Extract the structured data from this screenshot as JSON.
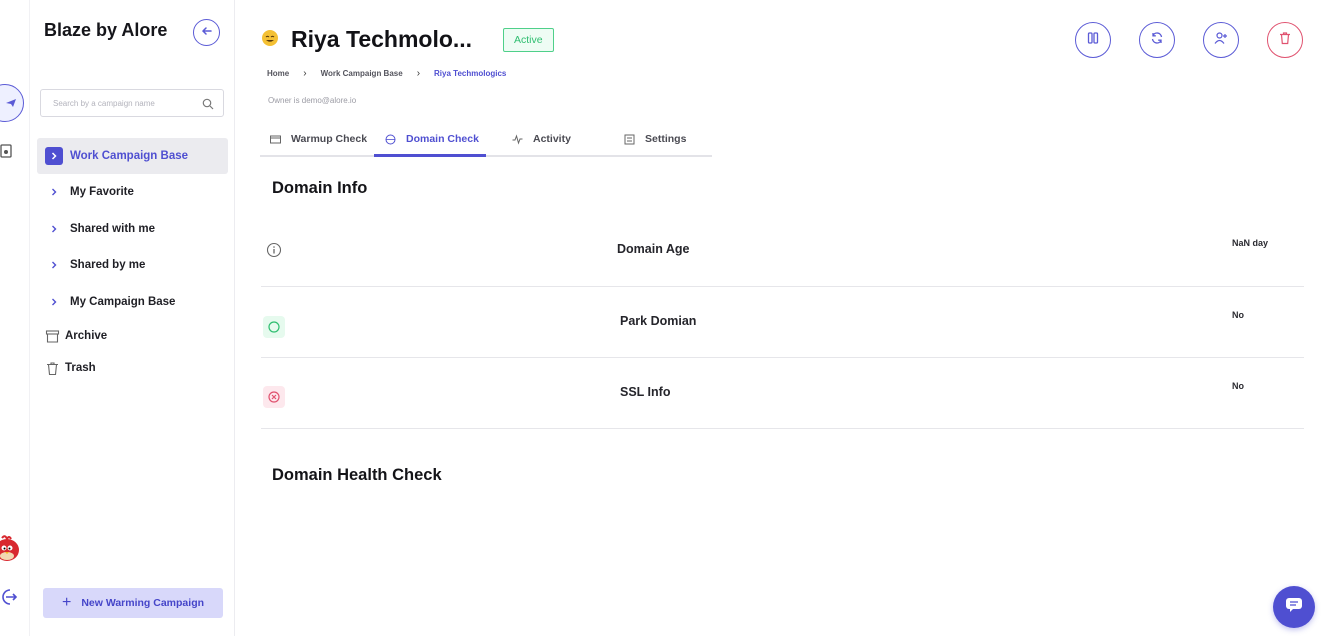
{
  "app": {
    "brand": "Blaze by Alore"
  },
  "sidebar": {
    "search_placeholder": "Search by a campaign name",
    "items": [
      {
        "label": "Work Campaign Base",
        "active": true
      },
      {
        "label": "My Favorite"
      },
      {
        "label": "Shared with me"
      },
      {
        "label": "Shared by me"
      },
      {
        "label": "My Campaign Base"
      }
    ],
    "archive_label": "Archive",
    "trash_label": "Trash",
    "new_campaign_label": "New Warming Campaign"
  },
  "header": {
    "title": "Riya Techmolo...",
    "status_badge": "Active",
    "breadcrumb": [
      "Home",
      "Work Campaign Base",
      "Riya Techmologics"
    ],
    "owner": "Owner is demo@alore.io"
  },
  "tabs": [
    {
      "label": "Warmup Check",
      "icon": "mail-icon"
    },
    {
      "label": "Domain Check",
      "icon": "globe-icon",
      "active": true
    },
    {
      "label": "Activity",
      "icon": "activity-icon"
    },
    {
      "label": "Settings",
      "icon": "settings-icon"
    }
  ],
  "actions": [
    {
      "icon": "pause-icon"
    },
    {
      "icon": "refresh-icon"
    },
    {
      "icon": "add-user-icon"
    },
    {
      "icon": "trash-icon"
    }
  ],
  "domain_info": {
    "title": "Domain Info",
    "rows": [
      {
        "label": "Domain Age",
        "value": "NaN day",
        "icon": "info-icon",
        "status": "neutral"
      },
      {
        "label": "Park Domian",
        "value": "No",
        "icon": "check-circle-icon",
        "status": "success"
      },
      {
        "label": "SSL Info",
        "value": "No",
        "icon": "x-circle-icon",
        "status": "error"
      }
    ]
  },
  "domain_health": {
    "title": "Domain Health Check"
  },
  "colors": {
    "accent": "#4f4fd1",
    "success": "#2fbe70",
    "danger": "#e0526f"
  }
}
